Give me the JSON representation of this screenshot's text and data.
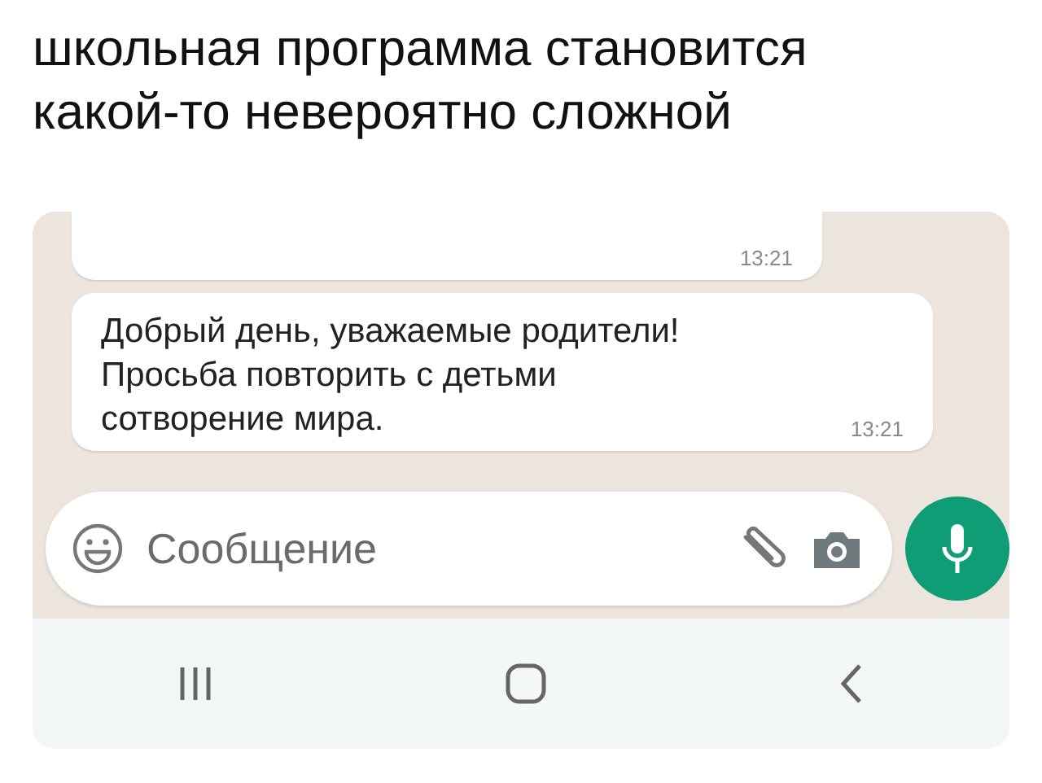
{
  "caption": {
    "lines": [
      "школьная программа становится",
      "какой-то невероятно сложной"
    ]
  },
  "messages": [
    {
      "time": "13:21"
    },
    {
      "lines": [
        "Добрый день, уважаемые родители!",
        "Просьба повторить с детьми",
        "сотворение мира."
      ],
      "time": "13:21"
    }
  ],
  "composer": {
    "placeholder": "Сообщение"
  }
}
